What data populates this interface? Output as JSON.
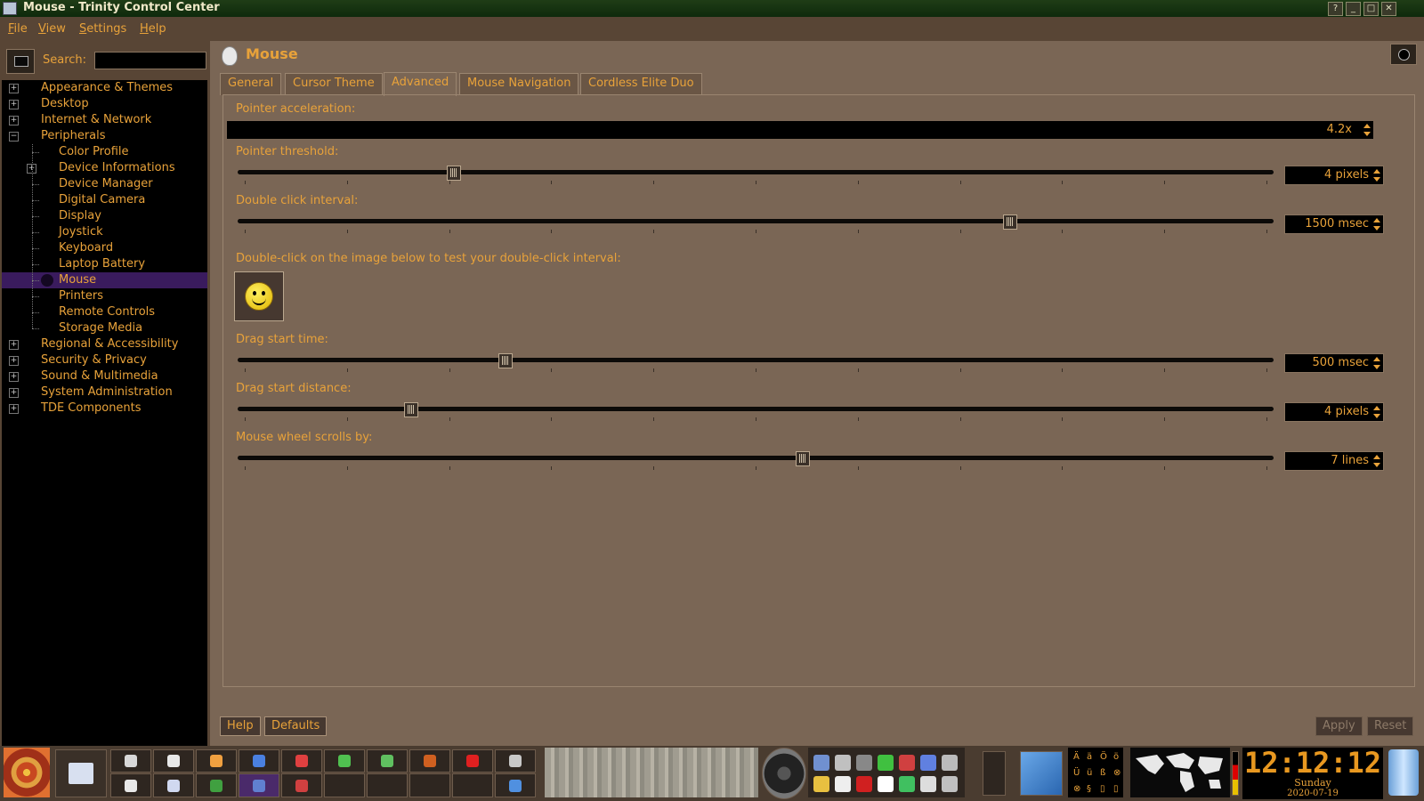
{
  "window": {
    "title": "Mouse - Trinity Control Center",
    "buttons": [
      "?",
      "_",
      "□",
      "✕"
    ]
  },
  "menubar": [
    {
      "label": "File",
      "mnemonic": "F",
      "rest": "ile"
    },
    {
      "label": "View",
      "mnemonic": "V",
      "rest": "iew"
    },
    {
      "label": "Settings",
      "mnemonic": "S",
      "rest": "ettings"
    },
    {
      "label": "Help",
      "mnemonic": "H",
      "rest": "elp"
    }
  ],
  "search": {
    "label": "Search:",
    "value": ""
  },
  "tree": {
    "top_items": [
      "Appearance & Themes",
      "Desktop",
      "Internet & Network",
      "Peripherals"
    ],
    "peripherals_children": [
      "Color Profile",
      "Device Informations",
      "Device Manager",
      "Digital Camera",
      "Display",
      "Joystick",
      "Keyboard",
      "Laptop Battery",
      "Mouse",
      "Printers",
      "Remote Controls",
      "Storage Media"
    ],
    "bottom_items": [
      "Regional & Accessibility",
      "Security & Privacy",
      "Sound & Multimedia",
      "System Administration",
      "TDE Components"
    ],
    "selected": "Mouse"
  },
  "page": {
    "title": "Mouse"
  },
  "tabs": [
    "General",
    "Cursor Theme",
    "Advanced",
    "Mouse Navigation",
    "Cordless Elite Duo"
  ],
  "active_tab": "Advanced",
  "advanced": {
    "pointer_acceleration": {
      "label": "Pointer acceleration:",
      "value": "4.2x"
    },
    "pointer_threshold": {
      "label": "Pointer threshold:",
      "value": "4 pixels",
      "fraction": 0.205
    },
    "double_click_interval": {
      "label": "Double click interval:",
      "value": "1500 msec",
      "fraction": 0.749
    },
    "double_click_test": {
      "label": "Double-click on the image below to test your double-click interval:"
    },
    "drag_start_time": {
      "label": "Drag start time:",
      "value": "500 msec",
      "fraction": 0.255
    },
    "drag_start_distance": {
      "label": "Drag start distance:",
      "value": "4 pixels",
      "fraction": 0.163
    },
    "mouse_wheel_scrolls": {
      "label": "Mouse wheel scrolls by:",
      "value": "7 lines",
      "fraction": 0.546
    }
  },
  "footer": {
    "help": "Help",
    "defaults": "Defaults",
    "apply": "Apply",
    "reset": "Reset"
  },
  "taskbar": {
    "clock_time": "12:12:12",
    "clock_day": "Sunday",
    "clock_date": "2020-07-19",
    "keyboard_chars": [
      "Ä",
      "ä",
      "Ö",
      "ö",
      "Ü",
      "ü",
      "ß",
      "⊗",
      "⊗",
      "§",
      "▯",
      "▯"
    ]
  }
}
